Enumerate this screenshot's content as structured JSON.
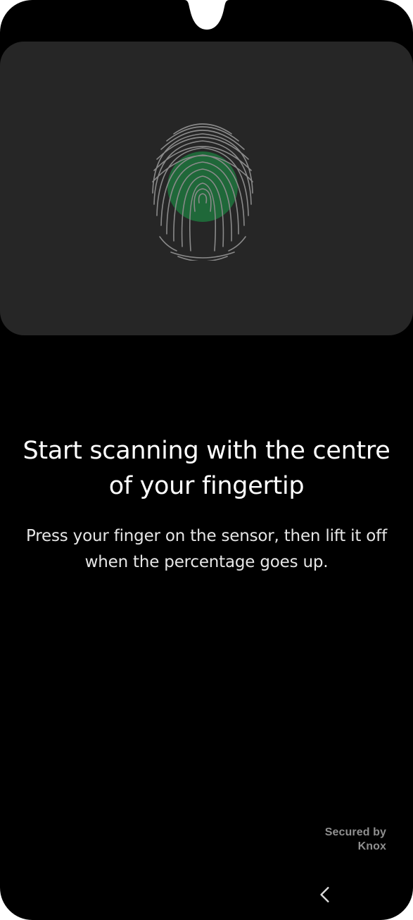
{
  "instruction": {
    "title": "Start scanning with the centre of your fingertip",
    "description": "Press your finger on the sensor, then lift it off when the percentage goes up."
  },
  "footer": {
    "secured_by": "Secured by",
    "brand": "Knox"
  },
  "navigation": {
    "back_icon": "chevron-left-icon"
  },
  "colors": {
    "background": "#000000",
    "panel": "#262626",
    "fingerprint_lines": "#8a8a8a",
    "sensor_highlight": "#1f6b3a"
  }
}
